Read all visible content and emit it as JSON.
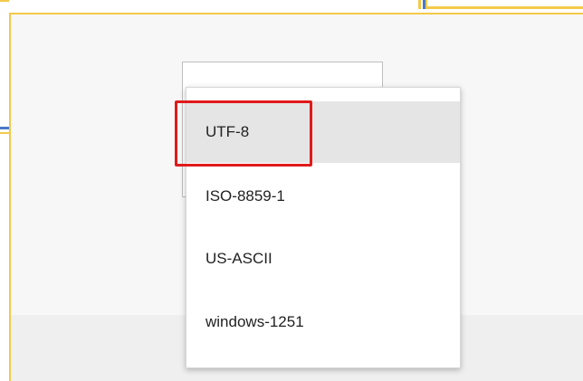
{
  "dropdown": {
    "options": [
      {
        "label": "UTF-8",
        "selected": true
      },
      {
        "label": "ISO-8859-1",
        "selected": false
      },
      {
        "label": "US-ASCII",
        "selected": false
      },
      {
        "label": "windows-1251",
        "selected": false
      }
    ]
  },
  "colors": {
    "dialog_border": "#f4c94a",
    "behind_window_accent": "#4a78c8",
    "highlight": "#e01a1a",
    "selected_option_bg": "#e5e5e5"
  }
}
